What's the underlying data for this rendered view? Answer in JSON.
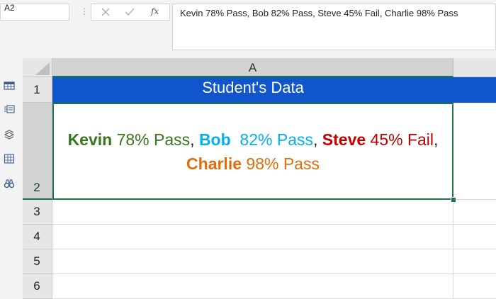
{
  "name_box": {
    "value": "A2"
  },
  "formula_bar": {
    "fx_label": "fx",
    "content": "Kevin 78% Pass, Bob  82% Pass, Steve 45% Fail, Charlie 98% Pass"
  },
  "column_headers": [
    "A"
  ],
  "row_headers": [
    "1",
    "2",
    "3",
    "4",
    "5",
    "6"
  ],
  "cells": {
    "A1": "Student's Data",
    "A2": {
      "runs": [
        {
          "text": "Kevin",
          "color": "#38761d",
          "bold": true
        },
        {
          "text": " 78% Pass",
          "color": "#38761d",
          "bold": false
        },
        {
          "text": ", ",
          "color": "#222222",
          "bold": false
        },
        {
          "text": "Bob",
          "color": "#00b0f0",
          "bold": true
        },
        {
          "text": "  82% Pass",
          "color": "#00b0f0",
          "bold": false
        },
        {
          "text": ", ",
          "color": "#222222",
          "bold": false
        },
        {
          "text": "Steve",
          "color": "#c00000",
          "bold": true
        },
        {
          "text": " 45% Fail",
          "color": "#c00000",
          "bold": false
        },
        {
          "text": ", ",
          "color": "#222222",
          "bold": false
        },
        {
          "text": "Charlie",
          "color": "#e36c09",
          "bold": true
        },
        {
          "text": " 98% Pass",
          "color": "#e36c09",
          "bold": false
        }
      ]
    }
  },
  "colors": {
    "header_fill": "#1155cc",
    "header_text": "#ffffff",
    "selection": "#217346"
  },
  "sidebar_icons": [
    "table-icon",
    "list-icon",
    "stack-icon",
    "grid-icon",
    "binoculars-icon"
  ]
}
